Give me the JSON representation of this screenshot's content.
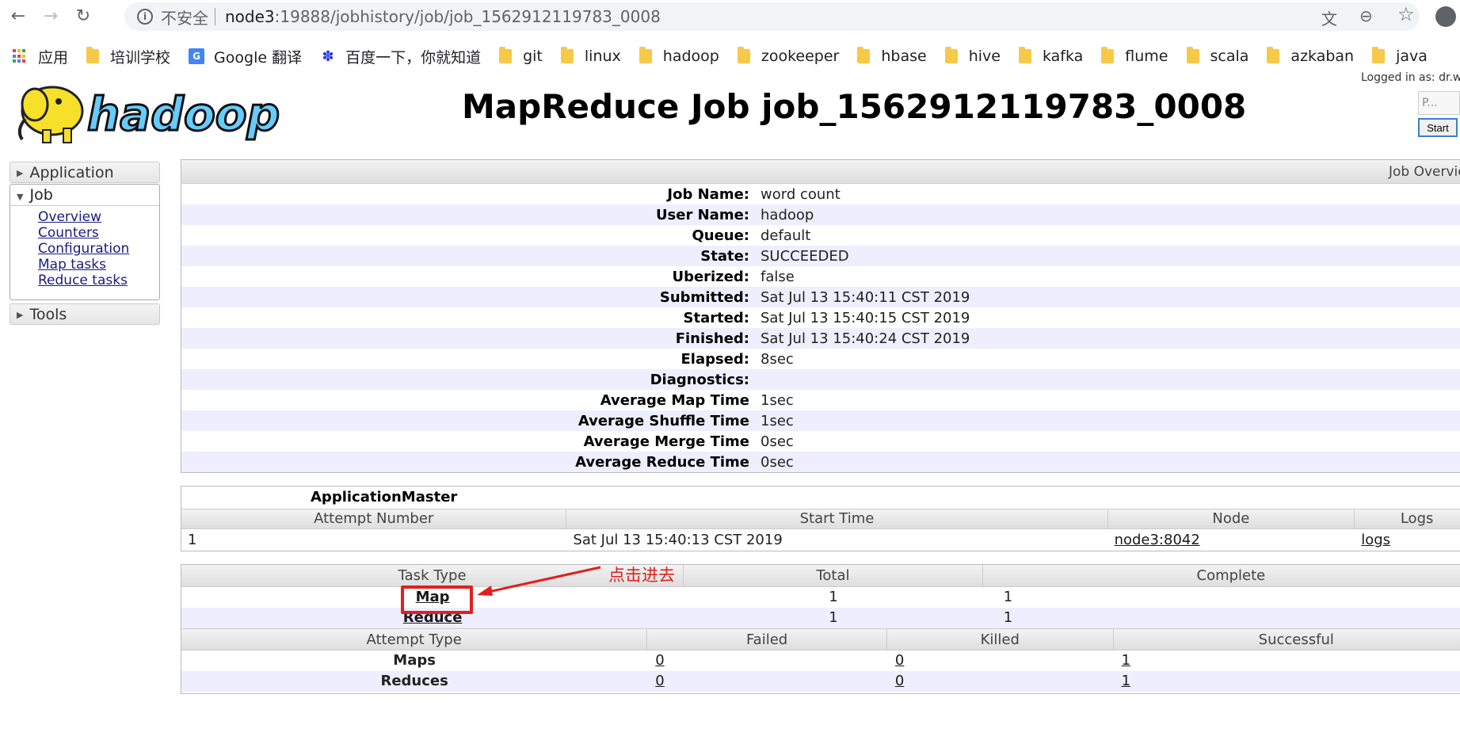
{
  "browser": {
    "back_icon": "←",
    "forward_icon": "→",
    "reload_icon": "↻",
    "security_text": "不安全",
    "url_host": "node3",
    "url_path": ":19888/jobhistory/job/job_1562912119783_0008",
    "translate_icon": "文",
    "zoom_icon": "⊖",
    "star_icon": "☆"
  },
  "bookmarks": [
    {
      "label": "应用",
      "icon": "apps-grid-icon"
    },
    {
      "label": "培训学校",
      "icon": "folder-icon"
    },
    {
      "label": "Google 翻译",
      "icon": "google-translate-icon"
    },
    {
      "label": "百度一下，你就知道",
      "icon": "baidu-paw-icon"
    },
    {
      "label": "git",
      "icon": "folder-icon"
    },
    {
      "label": "linux",
      "icon": "folder-icon"
    },
    {
      "label": "hadoop",
      "icon": "folder-icon"
    },
    {
      "label": "zookeeper",
      "icon": "folder-icon"
    },
    {
      "label": "hbase",
      "icon": "folder-icon"
    },
    {
      "label": "hive",
      "icon": "folder-icon"
    },
    {
      "label": "kafka",
      "icon": "folder-icon"
    },
    {
      "label": "flume",
      "icon": "folder-icon"
    },
    {
      "label": "scala",
      "icon": "folder-icon"
    },
    {
      "label": "azkaban",
      "icon": "folder-icon"
    },
    {
      "label": "java",
      "icon": "folder-icon"
    }
  ],
  "header": {
    "logo_text": "hadoop",
    "title": "MapReduce Job job_1562912119783_0008",
    "logged_in": "Logged in as: dr.w",
    "widget_text": "P...",
    "start_label": "Start"
  },
  "sidebar": {
    "application": "Application",
    "job": "Job",
    "job_links": [
      "Overview",
      "Counters",
      "Configuration",
      "Map tasks",
      "Reduce tasks"
    ],
    "tools": "Tools"
  },
  "overview": {
    "header": "Job Overview",
    "rows": [
      {
        "k": "Job Name:",
        "v": "word count"
      },
      {
        "k": "User Name:",
        "v": "hadoop"
      },
      {
        "k": "Queue:",
        "v": "default"
      },
      {
        "k": "State:",
        "v": "SUCCEEDED"
      },
      {
        "k": "Uberized:",
        "v": "false"
      },
      {
        "k": "Submitted:",
        "v": "Sat Jul 13 15:40:11 CST 2019"
      },
      {
        "k": "Started:",
        "v": "Sat Jul 13 15:40:15 CST 2019"
      },
      {
        "k": "Finished:",
        "v": "Sat Jul 13 15:40:24 CST 2019"
      },
      {
        "k": "Elapsed:",
        "v": "8sec"
      },
      {
        "k": "Diagnostics:",
        "v": ""
      },
      {
        "k": "Average Map Time",
        "v": "1sec"
      },
      {
        "k": "Average Shuffle Time",
        "v": "1sec"
      },
      {
        "k": "Average Merge Time",
        "v": "0sec"
      },
      {
        "k": "Average Reduce Time",
        "v": "0sec"
      }
    ]
  },
  "am": {
    "title": "ApplicationMaster",
    "columns": [
      "Attempt Number",
      "Start Time",
      "Node",
      "Logs"
    ],
    "row": {
      "attempt": "1",
      "start": "Sat Jul 13 15:40:13 CST 2019",
      "node": "node3:8042",
      "logs": "logs"
    }
  },
  "tasks": {
    "columns": [
      "Task Type",
      "Total",
      "Complete"
    ],
    "rows": [
      {
        "type": "Map",
        "total": "1",
        "complete": "1"
      },
      {
        "type": "Reduce",
        "total": "1",
        "complete": "1"
      }
    ],
    "attempt_columns": [
      "Attempt Type",
      "Failed",
      "Killed",
      "Successful"
    ],
    "attempt_rows": [
      {
        "type": "Maps",
        "failed": "0",
        "killed": "0",
        "successful": "1"
      },
      {
        "type": "Reduces",
        "failed": "0",
        "killed": "0",
        "successful": "1"
      }
    ]
  },
  "annotation": {
    "text": "点击进去",
    "color": "#e0201c"
  }
}
